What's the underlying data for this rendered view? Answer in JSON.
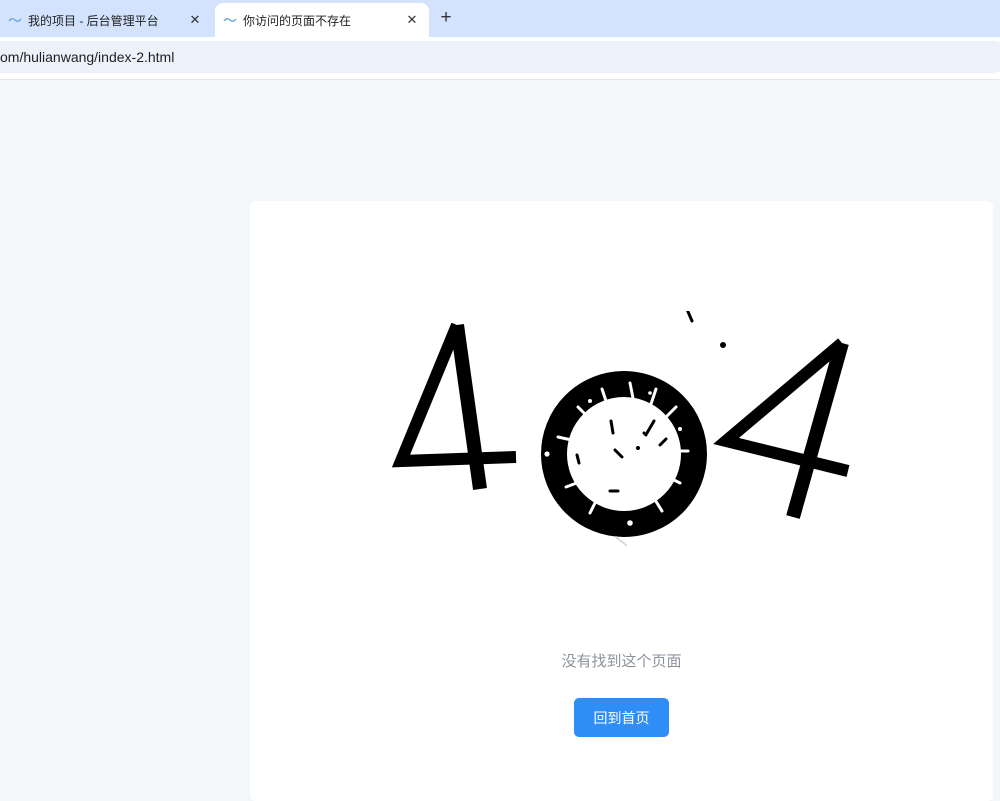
{
  "browser": {
    "tabs": [
      {
        "title": "我的项目 - 后台管理平台",
        "active": false,
        "close_icon": "close-icon"
      },
      {
        "title": "你访问的页面不存在",
        "active": true,
        "close_icon": "close-icon"
      }
    ],
    "new_tab_label": "+",
    "close_label": "✕",
    "address": "om/hulianwang/index-2.html"
  },
  "page": {
    "error_code": "404",
    "message": "没有找到这个页面",
    "home_button_label": "回到首页"
  },
  "colors": {
    "tabstrip": "#d3e3fd",
    "omnibox": "#edf2fa",
    "page_background": "#f4f7fa",
    "card": "#ffffff",
    "illustration": "#000000",
    "message_text": "#8d939b",
    "button": "#2f8ef6",
    "button_text": "#ffffff"
  }
}
